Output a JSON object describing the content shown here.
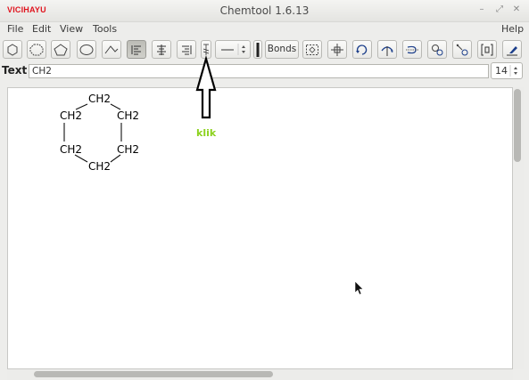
{
  "window": {
    "brand": "VICIHAYU",
    "title": "Chemtool 1.6.13",
    "controls": [
      "–",
      "⤢",
      "✕"
    ]
  },
  "menu": {
    "file": "File",
    "edit": "Edit",
    "view": "View",
    "tools": "Tools",
    "help": "Help"
  },
  "toolbar": {
    "bonds_label": "Bonds",
    "buttons": [
      "hexagon-icon",
      "octagon-icon",
      "pentagon-icon",
      "heptagon-icon",
      "chain-icon",
      "align-left-icon",
      "align-center-icon",
      "align-right-icon",
      "text-tool-icon",
      "line-style-combo",
      "line-width-icon",
      "bonds-button",
      "select-box-icon",
      "move-icon",
      "rotate-icon",
      "flip-icon",
      "flip-horizontal-icon",
      "mark-atom-icon",
      "mark-bond-icon",
      "bracket-icon",
      "eraser-icon"
    ]
  },
  "text_row": {
    "label": "Text :",
    "value": "CH2",
    "font_size": "14"
  },
  "molecule": {
    "atoms": [
      "CH2",
      "CH2",
      "CH2",
      "CH2",
      "CH2",
      "CH2"
    ]
  },
  "annotation": {
    "label": "klik"
  },
  "colors": {
    "brand": "#e0141e",
    "annotation": "#8cd21e"
  }
}
